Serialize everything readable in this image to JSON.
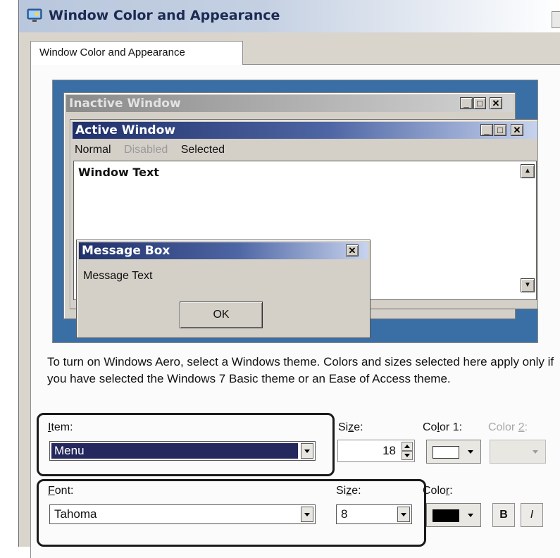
{
  "window": {
    "title": "Window Color and Appearance"
  },
  "tab": {
    "label": "Window Color and Appearance"
  },
  "preview": {
    "inactive_title": "Inactive Window",
    "active_title": "Active Window",
    "menu_normal": "Normal",
    "menu_disabled": "Disabled",
    "menu_selected": "Selected",
    "window_text": "Window Text",
    "message_box_title": "Message Box",
    "message_text": "Message Text",
    "ok_label": "OK",
    "btn_min": "_",
    "btn_max": "□",
    "btn_close": "✕"
  },
  "info_text": "To turn on Windows Aero, select a Windows theme.  Colors and sizes selected here apply only if you have selected the Windows 7 Basic theme or an Ease of Access theme.",
  "item": {
    "label_accel": "I",
    "label_rest": "tem:",
    "value": "Menu",
    "size_label_start": "Si",
    "size_label_accel": "z",
    "size_label_end": "e:",
    "size_value": "18",
    "color1_start": "Co",
    "color1_accel": "l",
    "color1_end": "or 1:",
    "color2_start": "Color ",
    "color2_accel": "2",
    "color2_end": ":",
    "color1_value": "#ffffff",
    "highlight_color": "#24285c"
  },
  "font": {
    "label_accel": "F",
    "label_rest": "ont:",
    "value": "Tahoma",
    "size_label_start": "Si",
    "size_label_accel": "z",
    "size_label_end": "e:",
    "size_value": "8",
    "color_start": "Colo",
    "color_accel": "r",
    "color_end": ":",
    "color_value": "#000000",
    "bold_label": "B",
    "italic_label": "I"
  }
}
